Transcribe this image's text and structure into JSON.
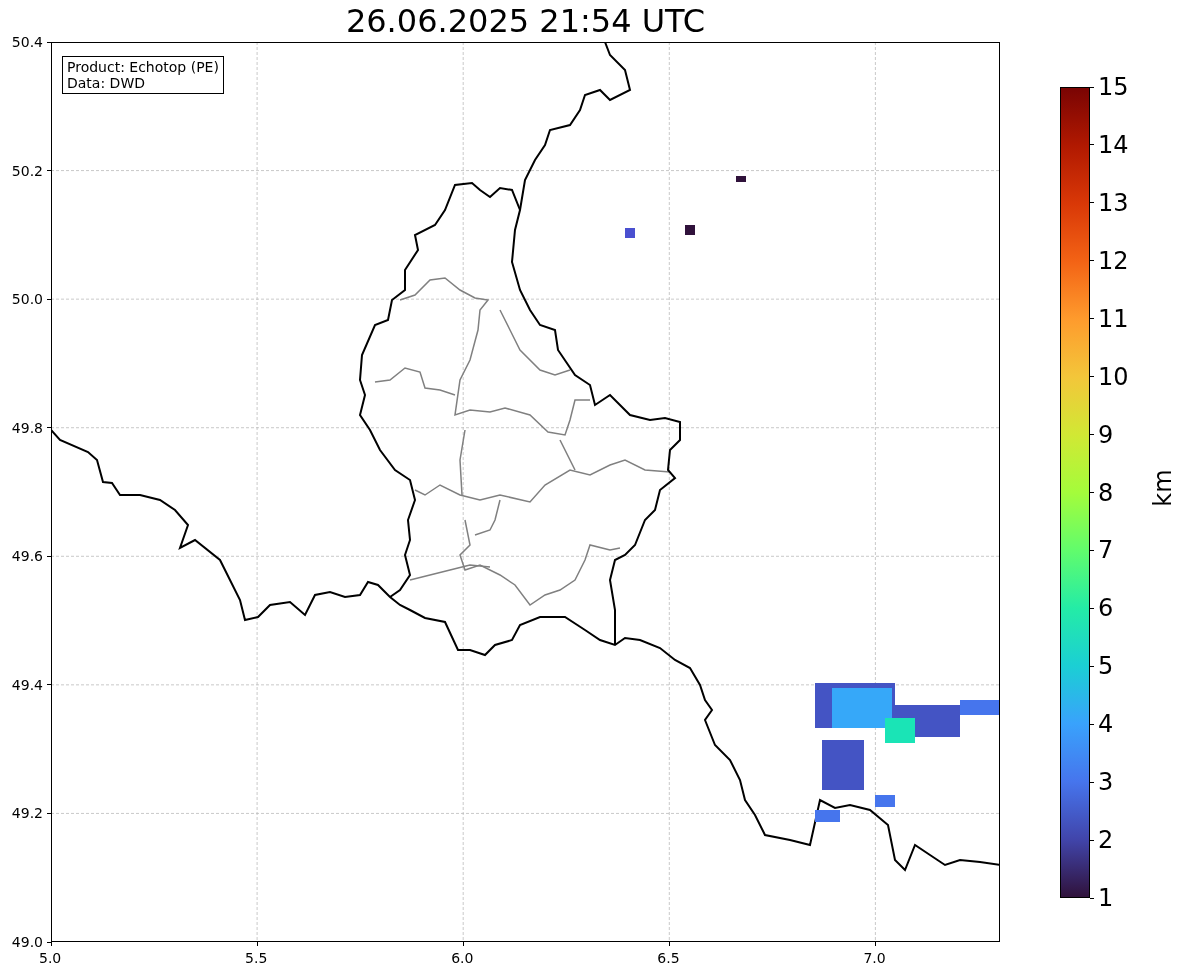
{
  "title": "26.06.2025 21:54 UTC",
  "info_box": [
    "Product: Echotop (PE)",
    "Data: DWD"
  ],
  "x_ticks": [
    "5.0",
    "5.5",
    "6.0",
    "6.5",
    "7.0"
  ],
  "y_ticks": [
    "50.4",
    "50.2",
    "50.0",
    "49.8",
    "49.6",
    "49.4",
    "49.2",
    "49.0"
  ],
  "colorbar": {
    "label": "km",
    "ticks": [
      "15",
      "14",
      "13",
      "12",
      "11",
      "10",
      "9",
      "8",
      "7",
      "6",
      "5",
      "4",
      "3",
      "2",
      "1"
    ]
  }
}
